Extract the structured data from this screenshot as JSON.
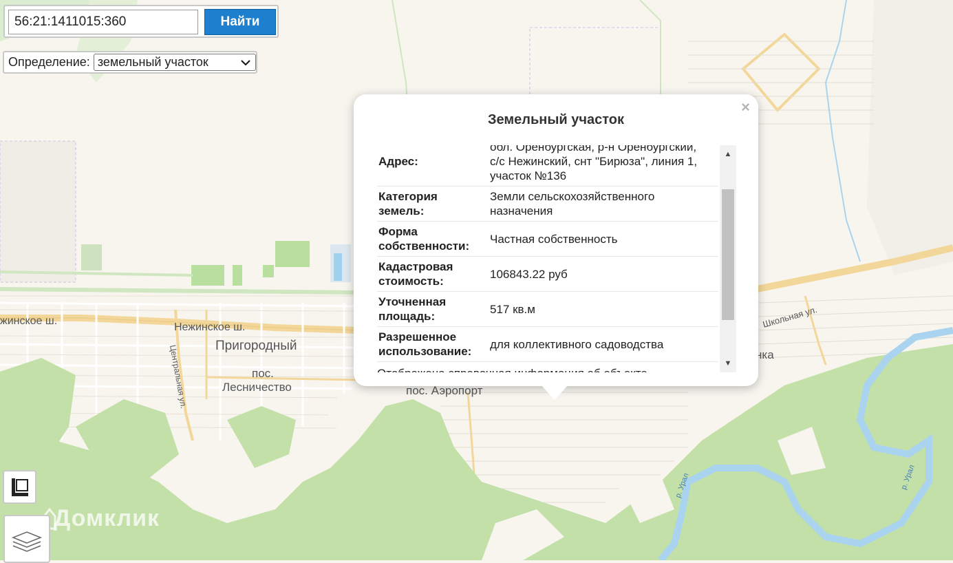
{
  "search": {
    "value": "56:21:1411015:360",
    "button_label": "Найти"
  },
  "definition": {
    "label": "Определение:",
    "selected": "земельный участок"
  },
  "map_labels": {
    "nezhinskoe_left": "жинское ш.",
    "nezhinskoe_center": "Нежинское ш.",
    "prigorodny": "Пригородный",
    "poselok": "пос.",
    "leshnichestvo": "Лесничество",
    "aeroport": "пос. Аэропорт",
    "centralnaya": "Центральная ул.",
    "shkolnaya": "Школьная ул.",
    "nka": "нка",
    "ural_1": "р. Урал",
    "ural_2": "р. Урал"
  },
  "popup": {
    "title": "Земельный участок",
    "close_symbol": "×",
    "rows": [
      {
        "key": "Адрес",
        "value_lines": [
          "обл. Оренбургская, р-н Оренбургский,",
          "с/с Нежинский, снт \"Бирюза\", линия 1,",
          "участок №136"
        ]
      },
      {
        "key": "Категория земель",
        "value_lines": [
          "Земли сельскохозяйственного",
          "назначения"
        ]
      },
      {
        "key": "Форма собственности",
        "value_lines": [
          "Частная собственность"
        ]
      },
      {
        "key": "Кадастровая стоимость",
        "value_lines": [
          "106843.22 руб"
        ]
      },
      {
        "key": "Уточненная площадь",
        "value_lines": [
          "517 кв.м"
        ]
      },
      {
        "key": "Разрешенное использование",
        "value_lines": [
          "для коллективного садоводства"
        ]
      }
    ],
    "note": "Отображена справочная информация об объекте"
  },
  "watermark": "Домклик",
  "icons": {
    "ruler": "ruler-icon",
    "layers": "layers-icon",
    "close": "close-icon"
  }
}
